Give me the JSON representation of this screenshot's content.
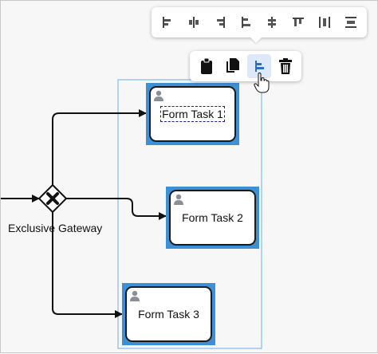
{
  "gateway": {
    "label": "Exclusive Gateway"
  },
  "tasks": [
    {
      "label": "Form Task 1",
      "editing": true
    },
    {
      "label": "Form Task 2",
      "editing": false
    },
    {
      "label": "Form Task 3",
      "editing": false
    }
  ],
  "align_toolbar": {
    "items": [
      {
        "icon": "align-left-icon"
      },
      {
        "icon": "align-center-icon"
      },
      {
        "icon": "align-right-icon"
      },
      {
        "icon": "align-left-edges-icon"
      },
      {
        "icon": "align-middle-icon"
      },
      {
        "icon": "align-top-icon"
      },
      {
        "icon": "distribute-horizontal-icon"
      },
      {
        "icon": "distribute-vertical-icon"
      }
    ]
  },
  "context_toolbar": {
    "items": [
      {
        "icon": "clipboard-icon"
      },
      {
        "icon": "copy-icon"
      },
      {
        "icon": "align-menu-icon",
        "active": true
      },
      {
        "icon": "trash-icon"
      }
    ]
  },
  "colors": {
    "selection": "#3d8fd6",
    "active_button_bg": "#dde9f8",
    "stroke": "#1a1a1a",
    "edit_border": "#1d1d9a"
  }
}
